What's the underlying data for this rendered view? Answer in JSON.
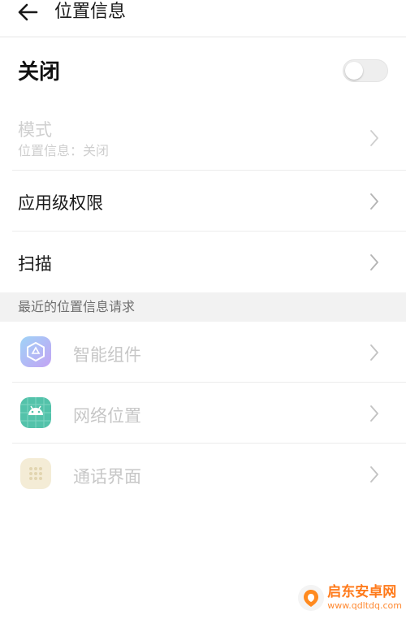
{
  "header": {
    "title": "位置信息"
  },
  "master": {
    "label": "关闭",
    "enabled": false
  },
  "settings": [
    {
      "label": "模式",
      "subtitle": "位置信息：关闭",
      "disabled": true
    },
    {
      "label": "应用级权限"
    },
    {
      "label": "扫描"
    }
  ],
  "recent": {
    "section_title": "最近的位置信息请求",
    "items": [
      {
        "name": "智能组件",
        "icon": "smart-widget-icon",
        "color": "#b9a7f5"
      },
      {
        "name": "网络位置",
        "icon": "android-icon",
        "color": "#4fc0a8"
      },
      {
        "name": "通话界面",
        "icon": "call-ui-icon",
        "color": "#f2e6c8"
      }
    ]
  },
  "watermark": {
    "name": "启东安卓网",
    "url": "www.qdltdq.com"
  }
}
